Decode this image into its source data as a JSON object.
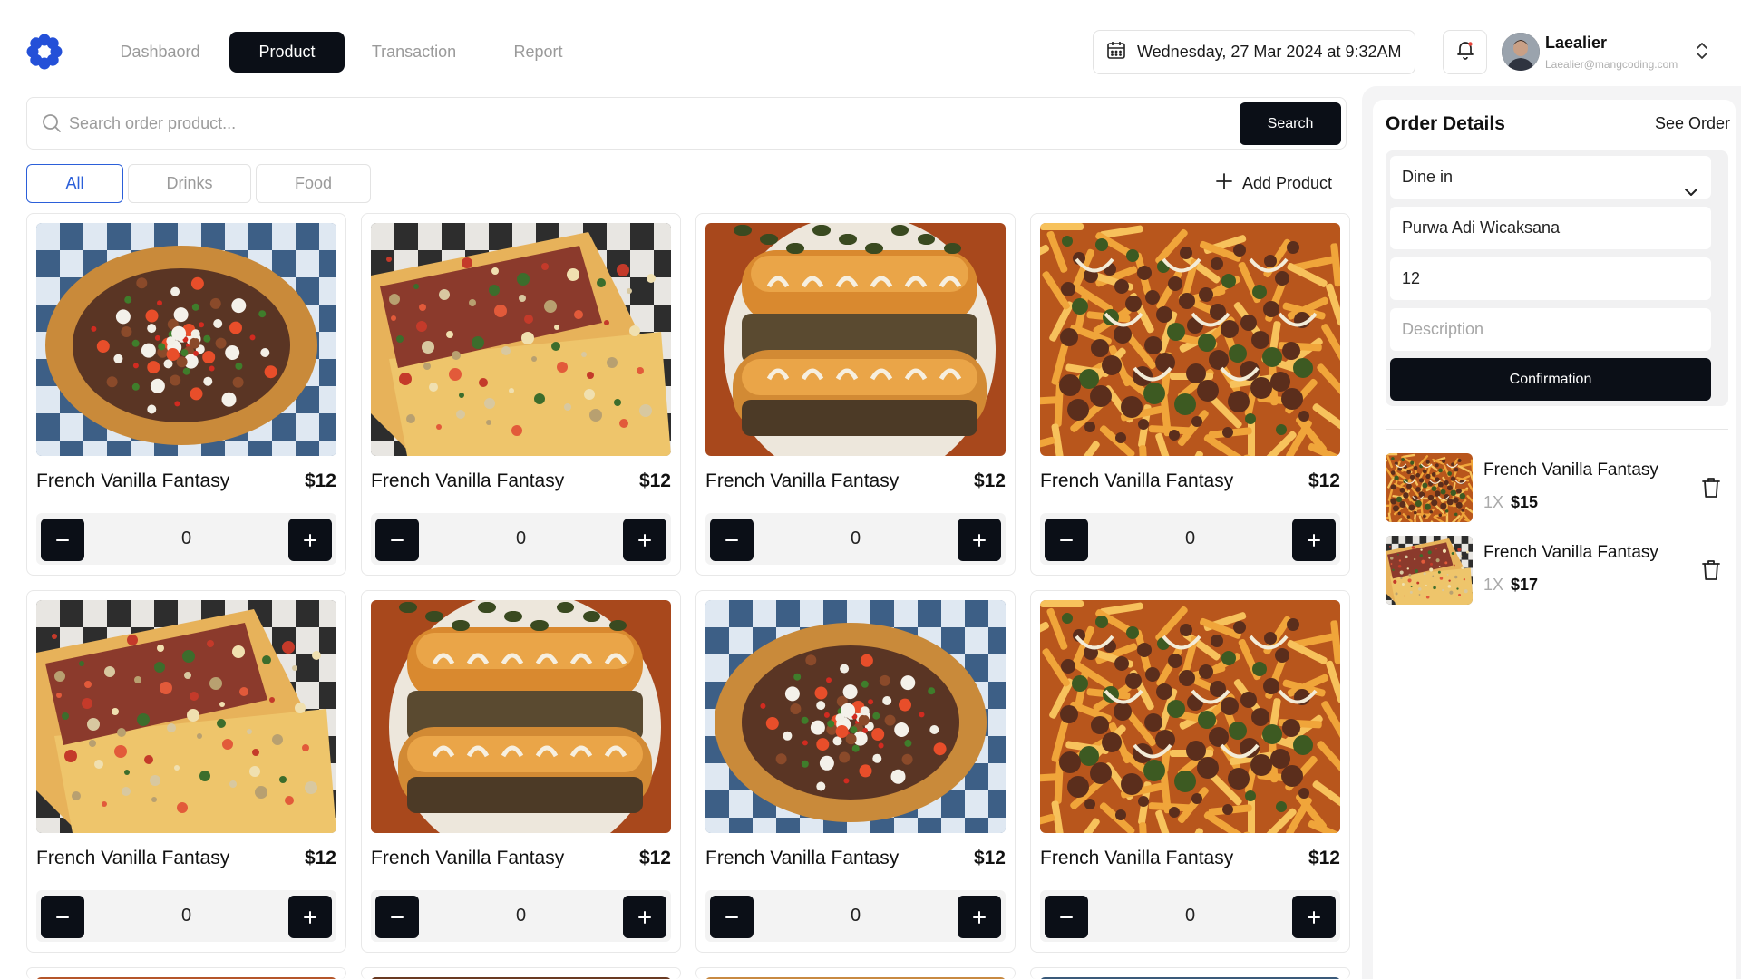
{
  "nav": {
    "tabs": [
      {
        "label": "Dashbaord",
        "active": false
      },
      {
        "label": "Product",
        "active": true
      },
      {
        "label": "Transaction",
        "active": false
      },
      {
        "label": "Report",
        "active": false
      }
    ]
  },
  "header": {
    "datetime": "Wednesday, 27 Mar 2024 at 9:32AM",
    "user_name": "Laealier",
    "user_email": "Laealier@mangcoding.com"
  },
  "search": {
    "placeholder": "Search order product...",
    "button_label": "Search"
  },
  "filters": [
    {
      "label": "All",
      "active": true
    },
    {
      "label": "Drinks",
      "active": false
    },
    {
      "label": "Food",
      "active": false
    }
  ],
  "add_product_label": "Add Product",
  "products": [
    {
      "name": "French Vanilla Fantasy",
      "price": "$12",
      "qty": "0",
      "image": "nachos"
    },
    {
      "name": "French Vanilla Fantasy",
      "price": "$12",
      "qty": "0",
      "image": "quesadilla"
    },
    {
      "name": "French Vanilla Fantasy",
      "price": "$12",
      "qty": "0",
      "image": "sandwich"
    },
    {
      "name": "French Vanilla Fantasy",
      "price": "$12",
      "qty": "0",
      "image": "fries"
    },
    {
      "name": "French Vanilla Fantasy",
      "price": "$12",
      "qty": "0",
      "image": "quesadilla"
    },
    {
      "name": "French Vanilla Fantasy",
      "price": "$12",
      "qty": "0",
      "image": "sandwich"
    },
    {
      "name": "French Vanilla Fantasy",
      "price": "$12",
      "qty": "0",
      "image": "nachos"
    },
    {
      "name": "French Vanilla Fantasy",
      "price": "$12",
      "qty": "0",
      "image": "fries"
    }
  ],
  "order": {
    "title": "Order Details",
    "see_order_label": "See Order",
    "dine_option": "Dine in",
    "customer_name": "Purwa Adi Wicaksana",
    "table_number": "12",
    "description_placeholder": "Description",
    "confirm_label": "Confirmation",
    "items": [
      {
        "name": "French Vanilla Fantasy",
        "qty": "1X",
        "price": "$15",
        "image": "fries"
      },
      {
        "name": "French Vanilla Fantasy",
        "qty": "1X",
        "price": "$17",
        "image": "quesadilla"
      }
    ]
  },
  "colors": {
    "primary_dark": "#0b0f17",
    "accent_blue": "#2b5fd9",
    "logo_blue": "#2450d8"
  }
}
